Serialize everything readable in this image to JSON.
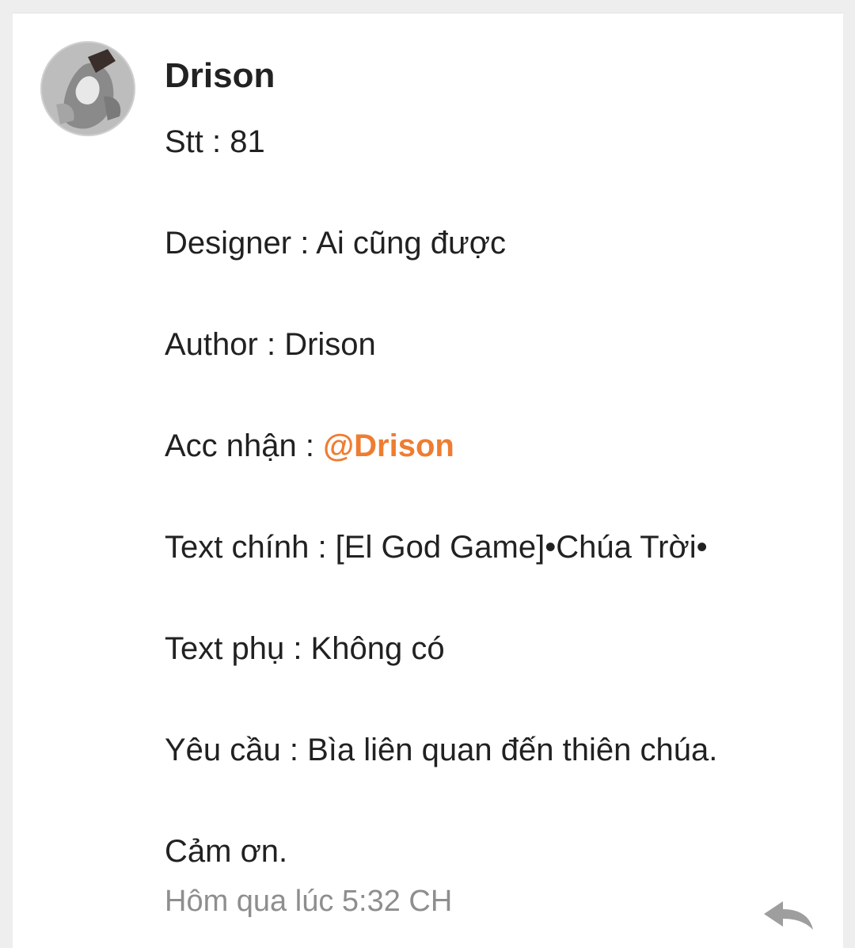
{
  "comment": {
    "author": "Drison",
    "lines": [
      "Stt : 81",
      "",
      "Designer : Ai cũng được",
      "",
      "Author : Drison",
      "",
      "",
      "",
      "Text chính : [El God Game]•Chúa Trời•",
      "",
      "Text phụ : Không có",
      "",
      "Yêu cầu : Bìa liên quan đến thiên chúa.",
      "",
      "Cảm ơn."
    ],
    "acc_label": "Acc nhận : ",
    "mention": "@Drison",
    "timestamp": "Hôm qua lúc 5:32 CH",
    "accent_color": "#ee7d31"
  },
  "icons": {
    "avatar": "avatar-image",
    "reply": "reply-arrow-icon"
  }
}
